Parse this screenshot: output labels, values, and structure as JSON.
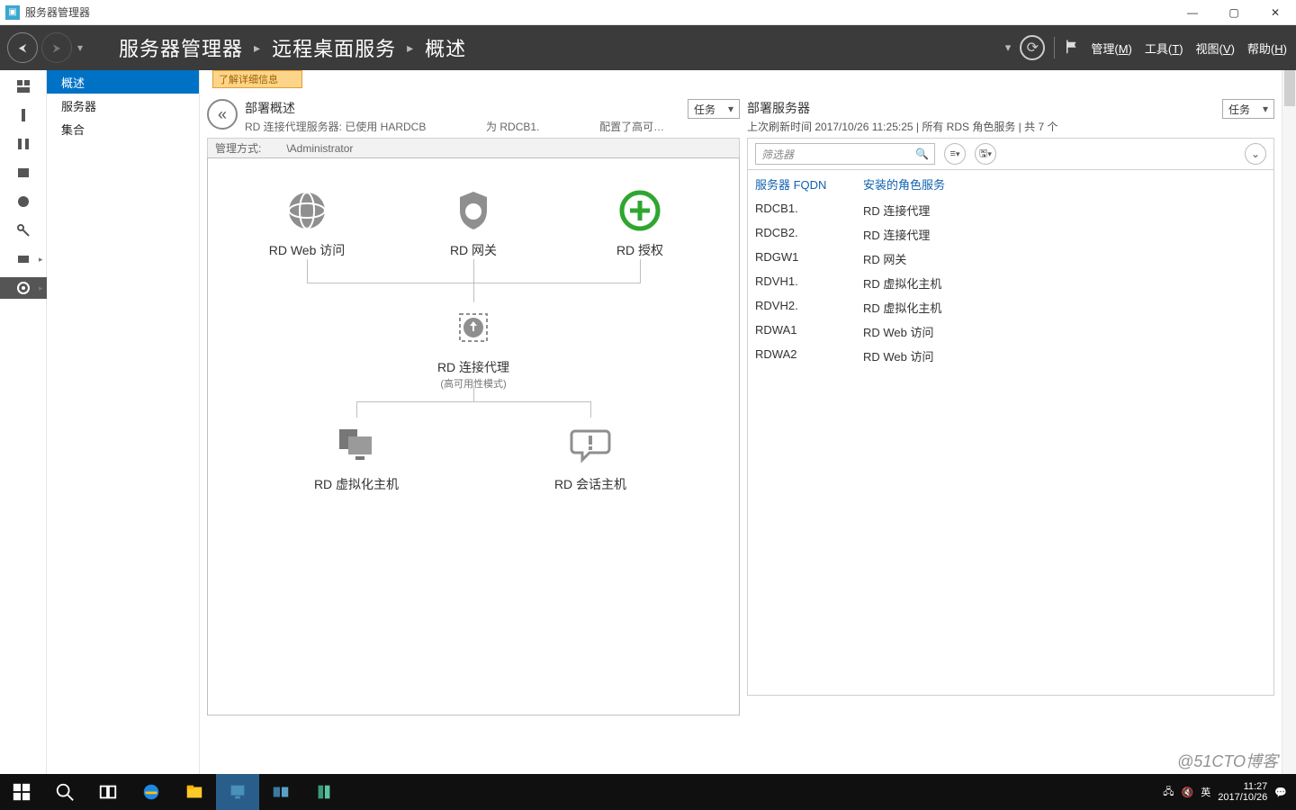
{
  "window": {
    "title": "服务器管理器"
  },
  "breadcrumb": {
    "a": "服务器管理器",
    "b": "远程桌面服务",
    "c": "概述"
  },
  "menus": {
    "manage": "管理",
    "manage_k": "M",
    "tools": "工具",
    "tools_k": "T",
    "view": "视图",
    "view_k": "V",
    "help": "帮助",
    "help_k": "H"
  },
  "side": {
    "items": [
      "概述",
      "服务器",
      "集合"
    ],
    "selected": 0
  },
  "hint": "了解详细信息",
  "overview": {
    "title": "部署概述",
    "sub_prefix": "RD 连接代理服务器: 已使用 HARDCB",
    "sub_mid": "为 RDCB1.",
    "sub_suffix": "配置了高可…",
    "tasks": "任务",
    "mgmt_label": "管理方式:",
    "mgmt_value": "\\Administrator",
    "nodes": {
      "web": "RD Web 访问",
      "gw": "RD 网关",
      "lic": "RD 授权",
      "cb": "RD 连接代理",
      "cb_sub": "(高可用性模式)",
      "vh": "RD 虚拟化主机",
      "sh": "RD 会话主机"
    }
  },
  "deploy": {
    "title": "部署服务器",
    "sub": "上次刷新时间 2017/10/26 11:25:25 | 所有 RDS 角色服务  | 共 7 个",
    "tasks": "任务",
    "filter_placeholder": "筛选器",
    "columns": {
      "fqdn": "服务器 FQDN",
      "role": "安装的角色服务"
    },
    "rows": [
      {
        "fqdn": "RDCB1.",
        "role": "RD 连接代理"
      },
      {
        "fqdn": "RDCB2.",
        "role": "RD 连接代理"
      },
      {
        "fqdn": "RDGW1",
        "role": "RD 网关"
      },
      {
        "fqdn": "RDVH1.",
        "role": "RD 虚拟化主机"
      },
      {
        "fqdn": "RDVH2.",
        "role": "RD 虚拟化主机"
      },
      {
        "fqdn": "RDWA1",
        "role": "RD Web 访问"
      },
      {
        "fqdn": "RDWA2",
        "role": "RD Web 访问"
      }
    ]
  },
  "tray": {
    "ime": "英",
    "time": "11:27",
    "date": "2017/10/26"
  },
  "watermark": "@51CTO博客"
}
